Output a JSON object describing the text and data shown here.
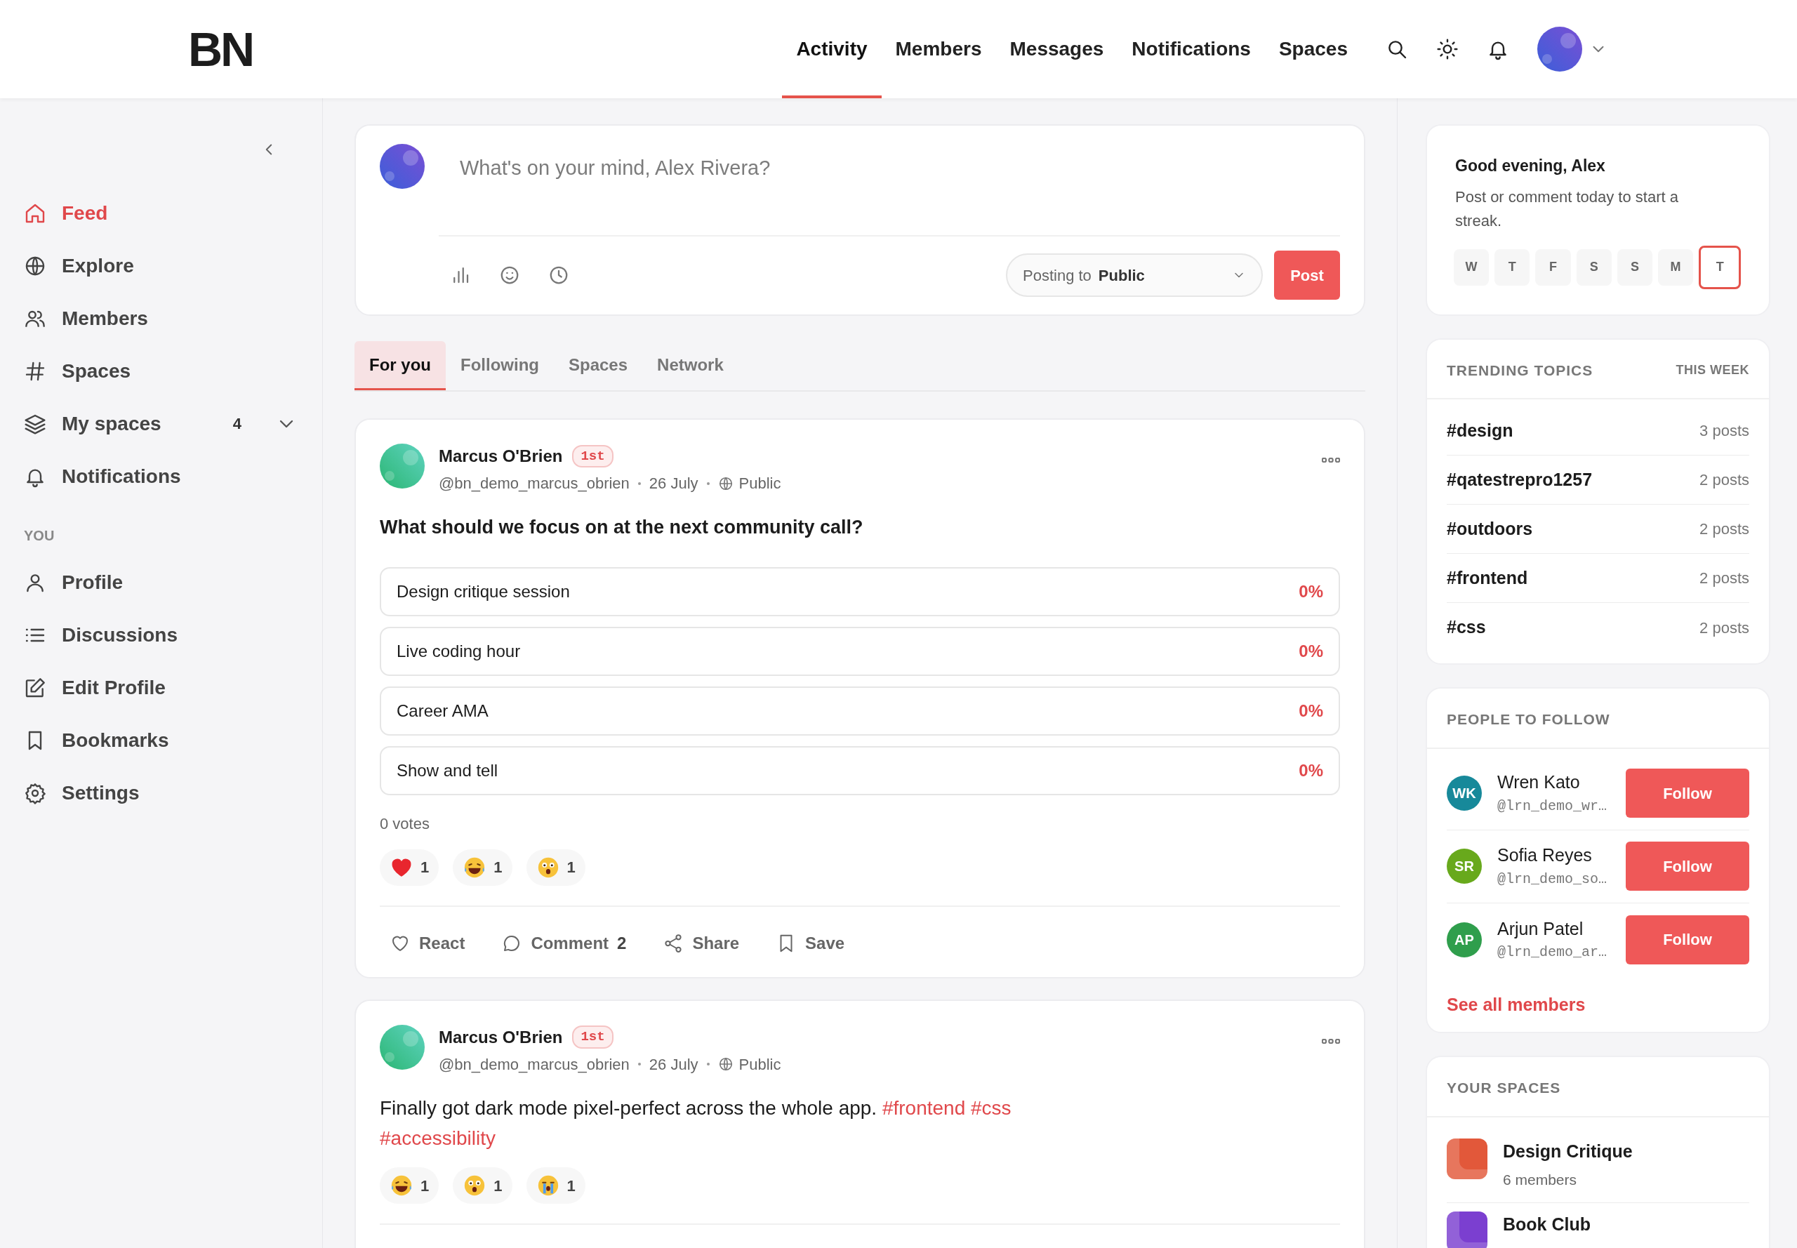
{
  "header": {
    "logo": "BN",
    "nav": [
      {
        "label": "Activity",
        "selected": true
      },
      {
        "label": "Members",
        "selected": false
      },
      {
        "label": "Messages",
        "selected": false
      },
      {
        "label": "Notifications",
        "selected": false
      },
      {
        "label": "Spaces",
        "selected": false
      }
    ]
  },
  "sidebar": {
    "items": [
      {
        "label": "Feed",
        "selected": true
      },
      {
        "label": "Explore",
        "selected": false
      },
      {
        "label": "Members",
        "selected": false
      },
      {
        "label": "Spaces",
        "selected": false
      },
      {
        "label": "My spaces",
        "count": "4",
        "selected": false
      },
      {
        "label": "Notifications",
        "selected": false
      }
    ],
    "section_title": "YOU",
    "section_items": [
      {
        "label": "Profile",
        "selected": false
      },
      {
        "label": "Discussions",
        "selected": false
      },
      {
        "label": "Edit Profile",
        "selected": false
      },
      {
        "label": "Bookmarks",
        "selected": false
      },
      {
        "label": "Settings",
        "selected": false
      }
    ]
  },
  "composer": {
    "placeholder": "What's on your mind, Alex Rivera?",
    "visibility_label": "Posting to",
    "visibility": "Public",
    "post_button": "Post"
  },
  "feed_tabs": [
    {
      "label": "For you",
      "selected": true
    },
    {
      "label": "Following",
      "selected": false
    },
    {
      "label": "Spaces",
      "selected": false
    },
    {
      "label": "Network",
      "selected": false
    }
  ],
  "posts": [
    {
      "kind": "poll",
      "author": "Marcus O'Brien",
      "badge": "1st",
      "handle": "@bn_demo_marcus_obrien",
      "date": "26 July",
      "audience": "Public",
      "question": "What should we focus on at the next community call?",
      "options": [
        {
          "label": "Design critique session",
          "percent": "0%"
        },
        {
          "label": "Live coding hour",
          "percent": "0%"
        },
        {
          "label": "Career AMA",
          "percent": "0%"
        },
        {
          "label": "Show and tell",
          "percent": "0%"
        }
      ],
      "votes": "0 votes",
      "reactions": [
        {
          "kind": "heart",
          "count": "1"
        },
        {
          "kind": "laugh",
          "count": "1"
        },
        {
          "kind": "wow",
          "count": "1"
        }
      ],
      "actions": [
        {
          "label": "React"
        },
        {
          "label": "Comment",
          "count": "2"
        },
        {
          "label": "Share"
        },
        {
          "label": "Save"
        }
      ]
    },
    {
      "kind": "text",
      "author": "Marcus O'Brien",
      "badge": "1st",
      "handle": "@bn_demo_marcus_obrien",
      "date": "26 July",
      "audience": "Public",
      "text": "Finally got dark mode pixel-perfect across the whole app.",
      "hashtags": [
        "#frontend",
        "#css",
        "#accessibility"
      ],
      "reactions": [
        {
          "kind": "laugh",
          "count": "1"
        },
        {
          "kind": "wow",
          "count": "1"
        },
        {
          "kind": "cry",
          "count": "1"
        }
      ]
    }
  ],
  "greeting": {
    "title": "Good evening, Alex",
    "text": "Post or comment today to start a streak.",
    "days": [
      {
        "label": "W",
        "selected": false
      },
      {
        "label": "T",
        "selected": false
      },
      {
        "label": "F",
        "selected": false
      },
      {
        "label": "S",
        "selected": false
      },
      {
        "label": "S",
        "selected": false
      },
      {
        "label": "M",
        "selected": false
      },
      {
        "label": "T",
        "selected": true
      }
    ]
  },
  "trending": {
    "title": "TRENDING TOPICS",
    "period": "THIS WEEK",
    "topics": [
      {
        "tag": "#design",
        "posts": "3 posts"
      },
      {
        "tag": "#qatestrepro1257",
        "posts": "2 posts"
      },
      {
        "tag": "#outdoors",
        "posts": "2 posts"
      },
      {
        "tag": "#frontend",
        "posts": "2 posts"
      },
      {
        "tag": "#css",
        "posts": "2 posts"
      }
    ]
  },
  "people": {
    "title": "PEOPLE TO FOLLOW",
    "people": [
      {
        "initials": "WK",
        "name": "Wren Kato",
        "handle": "@lrn_demo_wr…",
        "color": "#17899a",
        "button": "Follow"
      },
      {
        "initials": "SR",
        "name": "Sofia Reyes",
        "handle": "@lrn_demo_so…",
        "color": "#68a91c",
        "button": "Follow"
      },
      {
        "initials": "AP",
        "name": "Arjun Patel",
        "handle": "@lrn_demo_ar…",
        "color": "#2f9e4c",
        "button": "Follow"
      }
    ],
    "see_all": "See all members"
  },
  "spaces": {
    "title": "YOUR SPACES",
    "items": [
      {
        "name": "Design Critique",
        "members": "6 members",
        "color": "#e2583a"
      },
      {
        "name": "Book Club",
        "color": "#7b3fd0"
      }
    ]
  }
}
